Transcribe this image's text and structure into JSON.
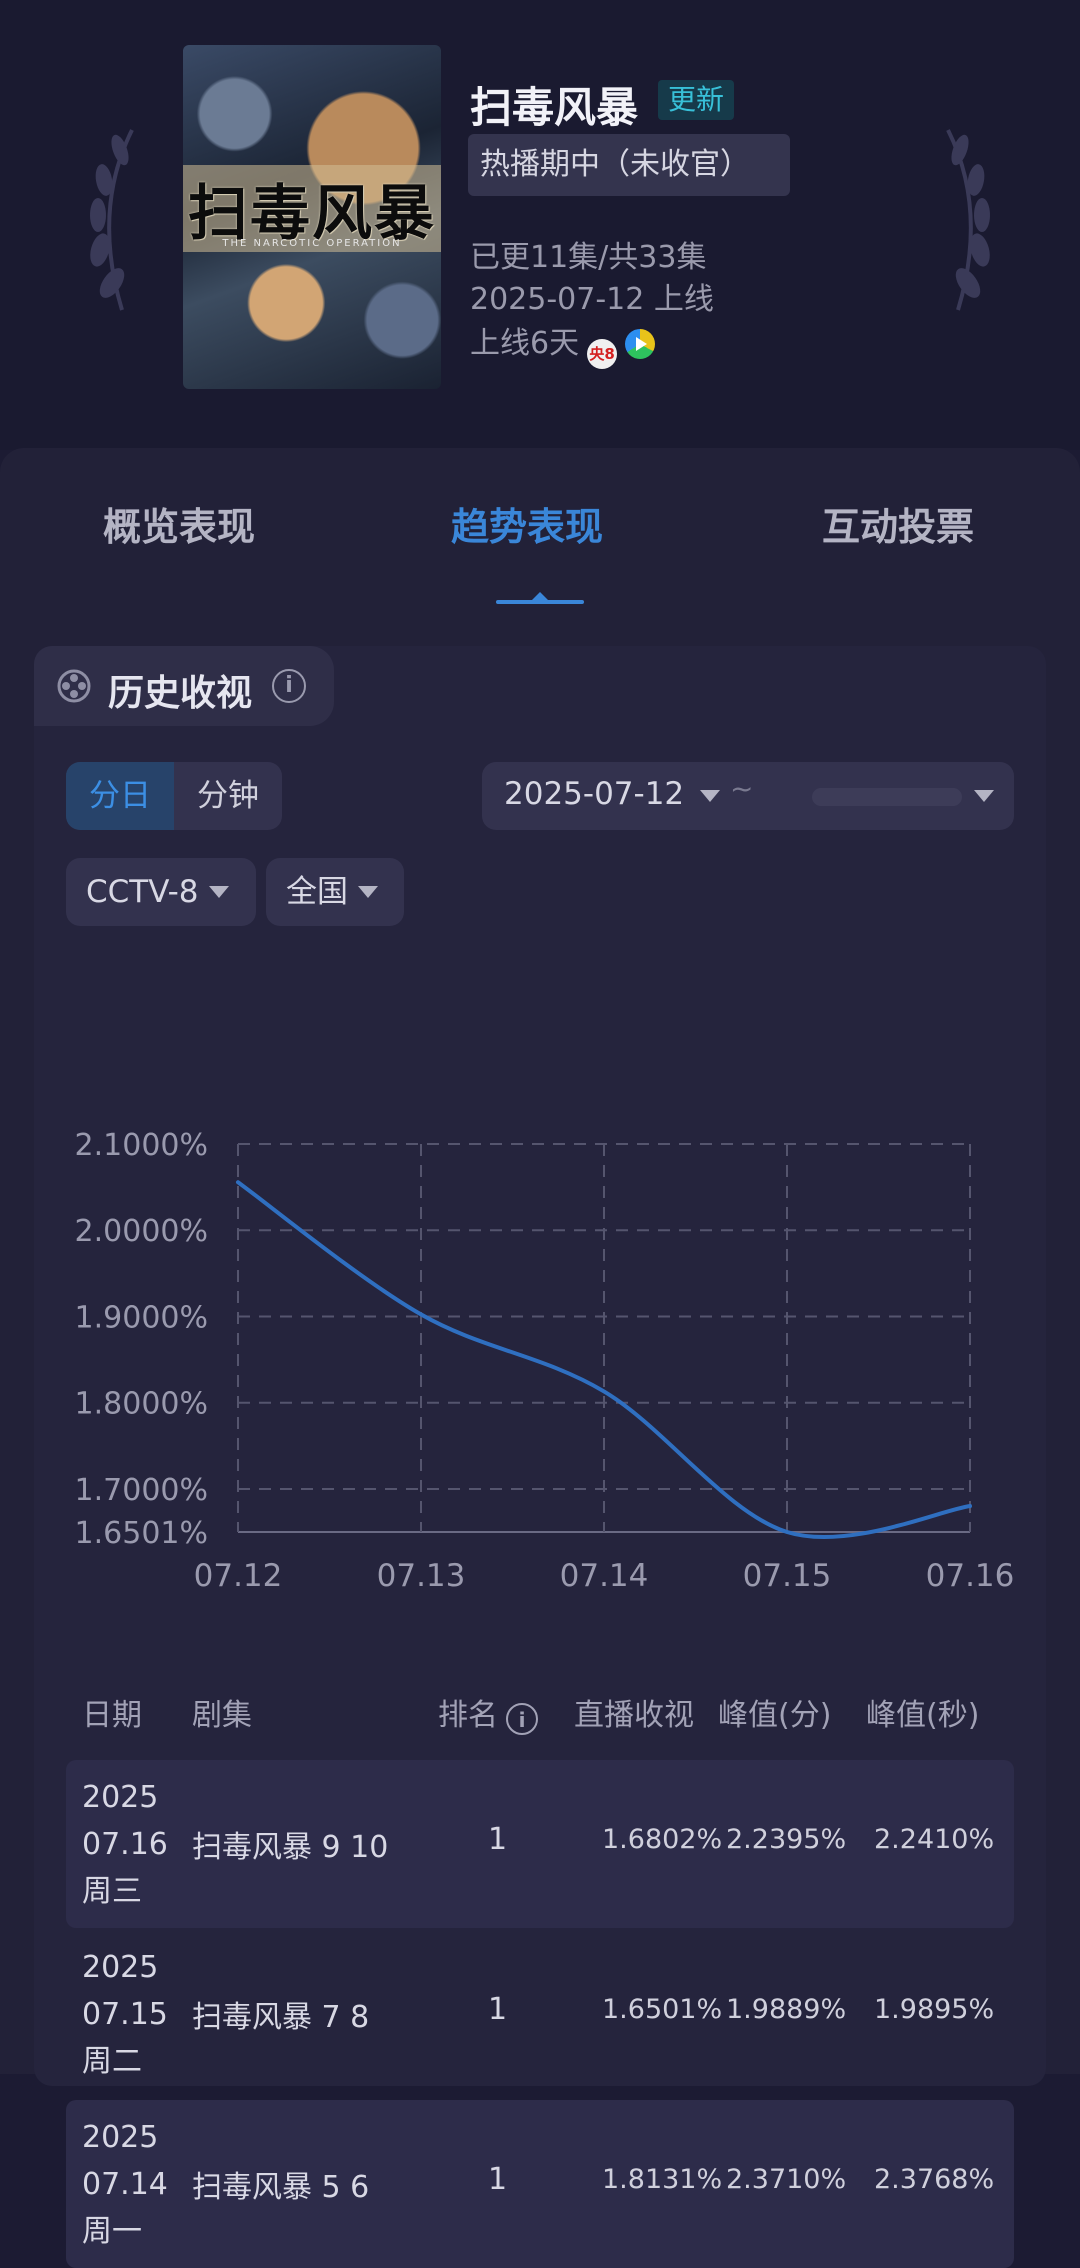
{
  "header": {
    "poster_title": "扫毒风暴",
    "poster_subtitle": "THE NARCOTIC OPERATION",
    "title": "扫毒风暴",
    "update_badge": "更新",
    "status": "热播期中（未收官）",
    "episodes": "已更11集/共33集",
    "premiere": "2025-07-12 上线",
    "days_online": "上线6天",
    "channel_badge": "央8",
    "icons": [
      "laurel-icon",
      "cctv8-icon",
      "iqiyi-icon"
    ]
  },
  "tabs": [
    "概览表现",
    "趋势表现",
    "互动投票"
  ],
  "active_tab": 1,
  "section": {
    "title": "历史收视",
    "icon": "film-reel-icon"
  },
  "filters": {
    "granularity": [
      "分日",
      "分钟"
    ],
    "granularity_selected": "分日",
    "date_start": "2025-07-12",
    "date_separator": "~",
    "channel": "CCTV-8",
    "region": "全国"
  },
  "chart_data": {
    "type": "line",
    "x": [
      "07.12",
      "07.13",
      "07.14",
      "07.15",
      "07.16"
    ],
    "series": [
      {
        "values": [
          2.0557,
          1.9024,
          1.8131,
          1.6501,
          1.6802
        ]
      }
    ],
    "yticks": [
      "2.1000%",
      "2.0000%",
      "1.9000%",
      "1.8000%",
      "1.7000%",
      "1.6501%"
    ],
    "ylim": [
      1.6501,
      2.1
    ],
    "grid": true,
    "line_color": "#2f6fc0"
  },
  "table": {
    "headers": [
      "日期",
      "剧集",
      "排名",
      "直播收视",
      "峰值(分)",
      "峰值(秒)"
    ],
    "rows": [
      {
        "year": "2025",
        "date": "07.16",
        "weekday": "周三",
        "episode": "扫毒风暴 9 10",
        "rank": "1",
        "live": "1.6802%",
        "peak_min": "2.2395%",
        "peak_sec": "2.2410%"
      },
      {
        "year": "2025",
        "date": "07.15",
        "weekday": "周二",
        "episode": "扫毒风暴 7 8",
        "rank": "1",
        "live": "1.6501%",
        "peak_min": "1.9889%",
        "peak_sec": "1.9895%"
      },
      {
        "year": "2025",
        "date": "07.14",
        "weekday": "周一",
        "episode": "扫毒风暴 5 6",
        "rank": "1",
        "live": "1.8131%",
        "peak_min": "2.3710%",
        "peak_sec": "2.3768%"
      }
    ]
  },
  "colors": {
    "background": "#1c1b33",
    "accent": "#3a86d8",
    "badge": "#38c0d8"
  }
}
